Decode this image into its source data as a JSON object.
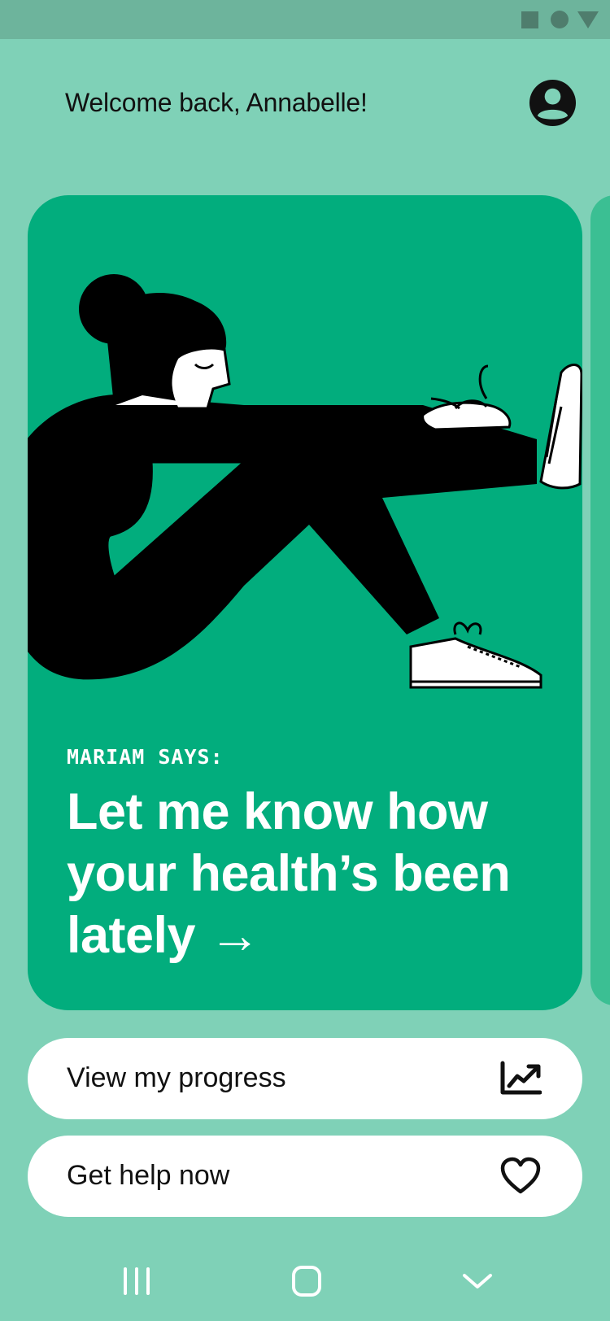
{
  "status_bar": {
    "icons": [
      "stop-square-icon",
      "record-circle-icon",
      "signal-triangle-icon"
    ],
    "color": "#4f7d6d"
  },
  "header": {
    "greeting": "Welcome back, Annabelle!",
    "avatar_icon": "user-avatar-icon"
  },
  "card": {
    "label": "MARIAM SAYS:",
    "title": "Let me know how your health’s been lately →",
    "illustration": "woman-stretching-illustration",
    "background": "#02ad7d"
  },
  "actions": [
    {
      "label": "View my progress",
      "icon": "chart-line-icon"
    },
    {
      "label": "Get help now",
      "icon": "heart-icon"
    }
  ],
  "nav_bar": {
    "icons": [
      "recent-apps-icon",
      "home-icon",
      "back-chevron-icon"
    ]
  },
  "colors": {
    "background": "#7fd1b7",
    "card": "#02ad7d",
    "button": "#ffffff",
    "text": "#111111"
  }
}
